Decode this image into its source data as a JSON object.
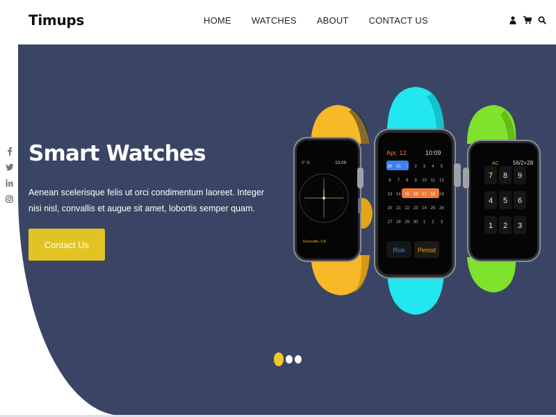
{
  "header": {
    "logo": "Timups",
    "nav": [
      "HOME",
      "WATCHES",
      "ABOUT",
      "CONTACT US"
    ],
    "icons": [
      "user-icon",
      "cart-icon",
      "search-icon"
    ]
  },
  "social": [
    "facebook-icon",
    "twitter-icon",
    "linkedin-icon",
    "instagram-icon"
  ],
  "hero": {
    "title": "Smart Watches",
    "description": "Aenean scelerisque felis ut orci condimentum laoreet. Integer nisi nisl, convallis et augue sit amet, lobortis semper quam.",
    "cta_label": "Contact Us",
    "slides": 3,
    "active_slide": 1
  },
  "watch_left": {
    "top_left": "0° N",
    "top_right": "10:09",
    "location": "Roseville, CA"
  },
  "watch_middle": {
    "date": "Apr, 12",
    "time": "10:09",
    "calendar": [
      [
        "30",
        "31",
        "1",
        "2",
        "3",
        "4",
        "5"
      ],
      [
        "6",
        "7",
        "8",
        "9",
        "10",
        "11",
        "12"
      ],
      [
        "13",
        "14",
        "15",
        "16",
        "17",
        "18",
        "19"
      ],
      [
        "20",
        "21",
        "22",
        "23",
        "24",
        "25",
        "26"
      ],
      [
        "27",
        "28",
        "29",
        "30",
        "1",
        "2",
        "3"
      ]
    ],
    "btn_left": "Risk",
    "btn_right": "Period"
  },
  "watch_right": {
    "ac": "AC",
    "display": "56/2=28",
    "keys": [
      "7",
      "8",
      "9",
      "4",
      "5",
      "6",
      "1",
      "2",
      "3"
    ]
  },
  "colors": {
    "hero_bg": "#3a4565",
    "accent": "#e1c324",
    "strap_yellow": "#f7b927",
    "strap_cyan": "#22e6f0",
    "strap_green": "#7fe22c"
  }
}
